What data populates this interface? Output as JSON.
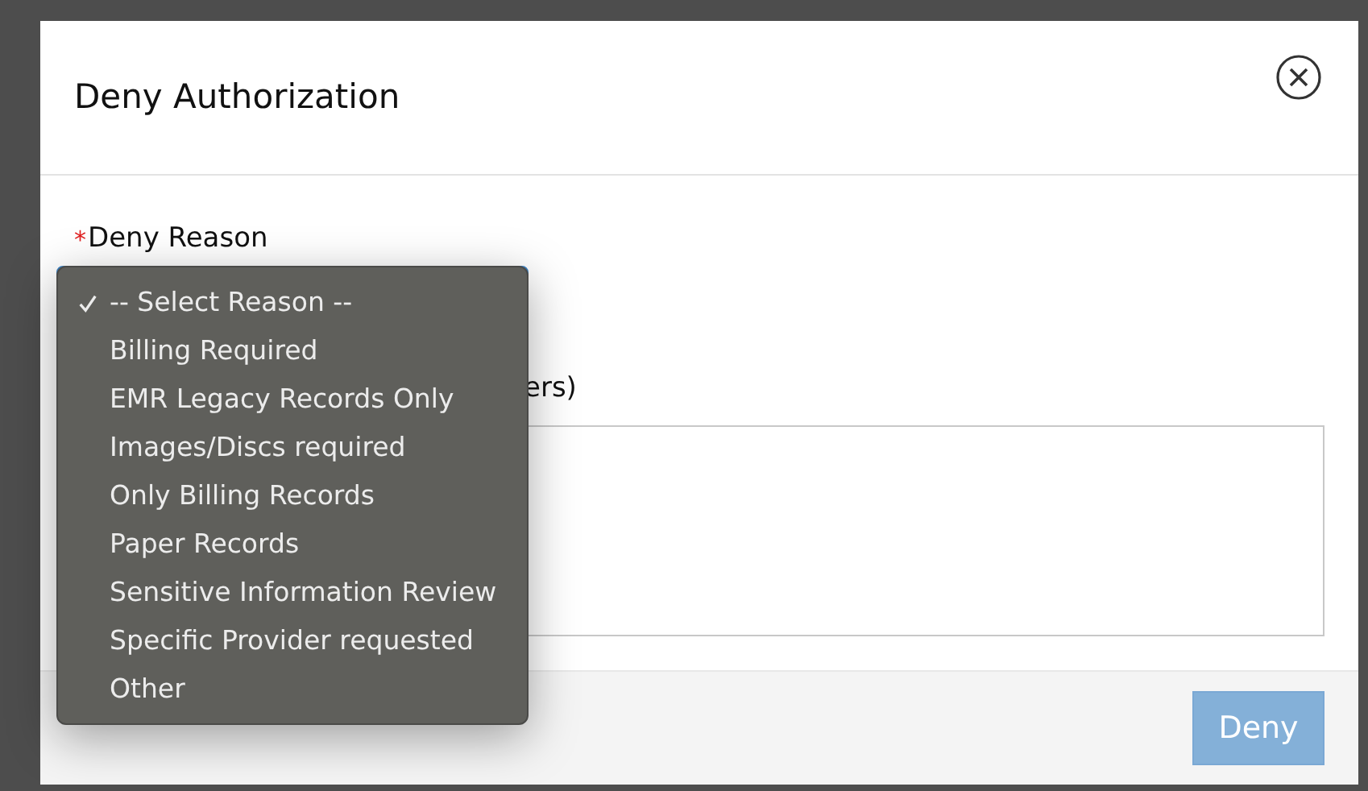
{
  "dialog": {
    "title": "Deny Authorization"
  },
  "deny_reason": {
    "required_mark": "*",
    "label": "Deny Reason",
    "options": [
      {
        "label": "-- Select Reason --",
        "selected": true
      },
      {
        "label": "Billing Required",
        "selected": false
      },
      {
        "label": "EMR Legacy Records Only",
        "selected": false
      },
      {
        "label": "Images/Discs required",
        "selected": false
      },
      {
        "label": "Only Billing Records",
        "selected": false
      },
      {
        "label": "Paper Records",
        "selected": false
      },
      {
        "label": "Sensitive Information Review",
        "selected": false
      },
      {
        "label": "Specific Provider requested",
        "selected": false
      },
      {
        "label": "Other",
        "selected": false
      }
    ]
  },
  "comments": {
    "label": "ers)"
  },
  "footer": {
    "button": {
      "label": "Deny",
      "disabled": true
    }
  }
}
